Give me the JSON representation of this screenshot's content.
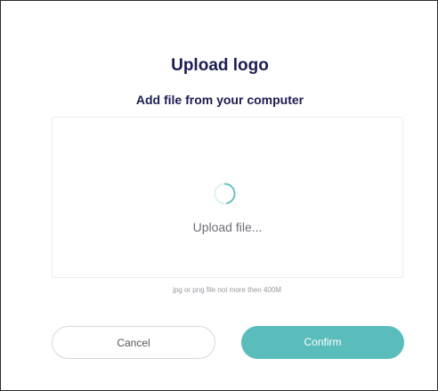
{
  "modal": {
    "title": "Upload logo",
    "subtitle": "Add file from your computer"
  },
  "dropzone": {
    "status_text": "Upload file...",
    "spinner_icon": "loading-spinner-icon",
    "spinner_color": "#5abdbc"
  },
  "hint": {
    "text": "jpg or png file not more then 400M"
  },
  "actions": {
    "cancel_label": "Cancel",
    "confirm_label": "Confirm"
  },
  "colors": {
    "title": "#1c1d52",
    "accent": "#5abdbc",
    "border": "#2b2b2b"
  }
}
